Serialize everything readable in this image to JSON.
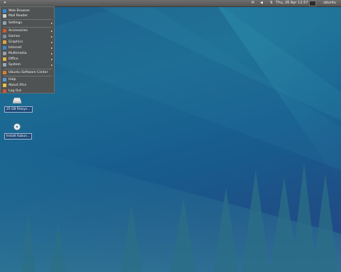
{
  "panel": {
    "clock": "Thu, 26 Apr  12:57",
    "user": "ubuntu"
  },
  "menu": {
    "items": [
      {
        "label": "Web Browser",
        "icon": "globe-icon",
        "color": "#3a8ad6",
        "submenu": false
      },
      {
        "label": "Mail Reader",
        "icon": "mail-icon",
        "color": "#cfcfcf",
        "submenu": false
      },
      {
        "label": "Settings",
        "icon": "settings-icon",
        "color": "#8fa3b7",
        "submenu": true
      },
      {
        "label": "Accessories",
        "icon": "accessories-icon",
        "color": "#d25a2b",
        "submenu": true
      },
      {
        "label": "Games",
        "icon": "games-icon",
        "color": "#7b8fa8",
        "submenu": true
      },
      {
        "label": "Graphics",
        "icon": "graphics-icon",
        "color": "#e2a83a",
        "submenu": true
      },
      {
        "label": "Internet",
        "icon": "internet-icon",
        "color": "#3f86c9",
        "submenu": true
      },
      {
        "label": "Multimedia",
        "icon": "multimedia-icon",
        "color": "#9aa0a6",
        "submenu": true
      },
      {
        "label": "Office",
        "icon": "office-icon",
        "color": "#e0b53a",
        "submenu": true
      },
      {
        "label": "System",
        "icon": "system-icon",
        "color": "#9aa7b4",
        "submenu": true
      },
      {
        "label": "Ubuntu Software Center",
        "icon": "software-center-icon",
        "color": "#d9822b",
        "submenu": false
      },
      {
        "label": "Help",
        "icon": "help-icon",
        "color": "#5a9ad8",
        "submenu": false
      },
      {
        "label": "About Xfce",
        "icon": "about-icon",
        "color": "#e6c64a",
        "submenu": false
      },
      {
        "label": "Log Out",
        "icon": "logout-icon",
        "color": "#c8583a",
        "submenu": false
      }
    ]
  },
  "desktop_icons": [
    {
      "label": "25 GB Filesys...",
      "icon": "drive-icon"
    },
    {
      "label": "Install Xubun...",
      "icon": "install-disc-icon"
    }
  ]
}
